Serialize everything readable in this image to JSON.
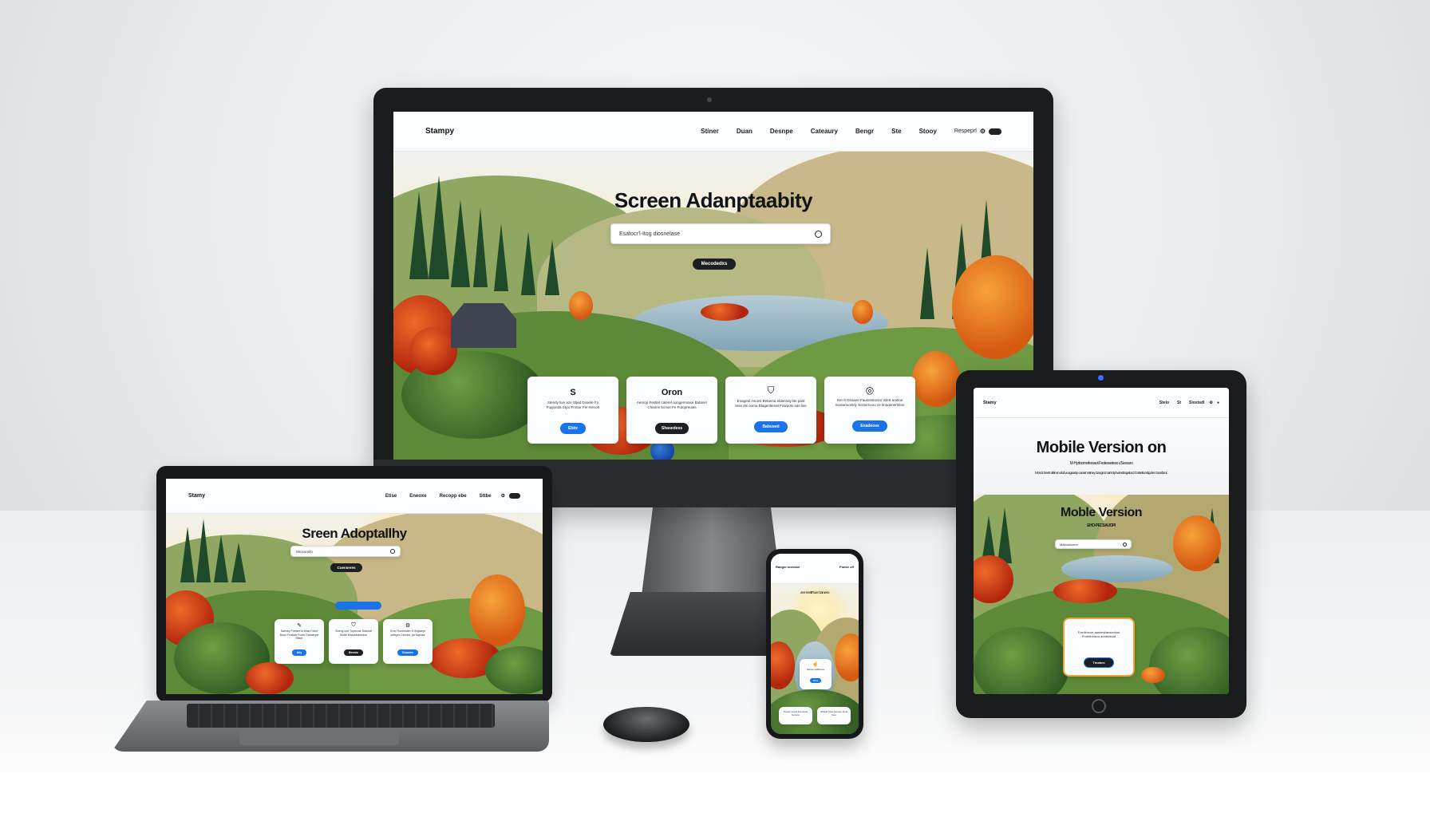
{
  "monitor": {
    "brand": "Stampy",
    "nav": [
      "Stiner",
      "Duan",
      "Desnpe",
      "Cateaury",
      "Bengr",
      "Ste",
      "Stooy",
      "Respeprl"
    ],
    "hero_title": "Screen Adanptaabity",
    "search_placeholder": "Esatocr'l-Itog diosnelase",
    "hero_button": "Mecodedxs",
    "cards": [
      {
        "title": "S",
        "desc": "Stendy tive aze Stjed Dosete Fo Fupjonda Stjoc'Frotior Fer-Hecott",
        "button": "Ebitz",
        "btn_style": "blue"
      },
      {
        "title": "Oron",
        "desc": "Aenrop Festlet caterel oongernnaxe Bataser Channs Scnoe Fe Futopreuats",
        "button": "Shasedess",
        "btn_style": "dark"
      },
      {
        "title": "",
        "desc": "Enageal Ascesl Betanna eldennay Be past teas dis oomu Btagentlenat Fowpoto sas lise",
        "button": "Babused",
        "btn_style": "blue"
      },
      {
        "title": "",
        "desc": "Sre S Dsoane Fausrestonlor istert aoeloe mxewnuonkly Scstornvoo ce lmaoenertirion",
        "button": "Enadeoss",
        "btn_style": "blue"
      }
    ]
  },
  "laptop": {
    "brand": "Stamy",
    "nav": [
      "Etise",
      "Eneoxe",
      "Recopp ebe",
      "Sttbe"
    ],
    "hero_title": "Sreen Adoptallhy",
    "search_placeholder": "Mrocsosto",
    "hero_button": "Cuenseres",
    "cta_button": "",
    "cards": [
      {
        "desc": "Saeney Foebee'st teste Fotoe Bouc Feutiote Fueer Daeaeryin Sfteer",
        "button": "Atiy"
      },
      {
        "desc": "Soeng ooe Tuprecae Sraocaf Slotte Mraosaoteedoo",
        "button": "Beesto"
      },
      {
        "desc": "Crxe Flonsenber S Snglaepr seteper Ceeolin, pa Sapose",
        "button": "Eroaees"
      }
    ]
  },
  "phone": {
    "brand": "Ranger enrosse",
    "nav": "Ftutse ofl",
    "title": "ane snettRow Garoeso",
    "card_text": "Nanse esdDroce",
    "card_button": "Tass",
    "bottom_cards": [
      "Foocer eoscl Fos Asue Gorenu",
      "Strlsdc Sole Aaouee Gosi Goe"
    ]
  },
  "tablet": {
    "brand": "Stamy",
    "nav": [
      "Stelo",
      "St",
      "Sioxtsdl"
    ],
    "hero_title": "Mobile Version on",
    "hero_sub": "M-Hydoomefesoaot Feolesseteso u'Sessuro",
    "hero_desc": "Mosot Seetr aitrinon aloit vuogaasty ooearmatney Saogncmarsntyhvanstrogelocd Gotsetiunstgoles Saosbroc",
    "second_title": "Moble Version",
    "second_sub": "EHO-PECSAUOPI",
    "search_placeholder": "Matnoesacm",
    "card_text": "Foetllmsue aastmsfaeoredost Frotetlonscu aurdetsuat",
    "card_button": "Tmabes"
  },
  "colors": {
    "accent": "#1a73e8",
    "dark": "#1d1f22"
  }
}
